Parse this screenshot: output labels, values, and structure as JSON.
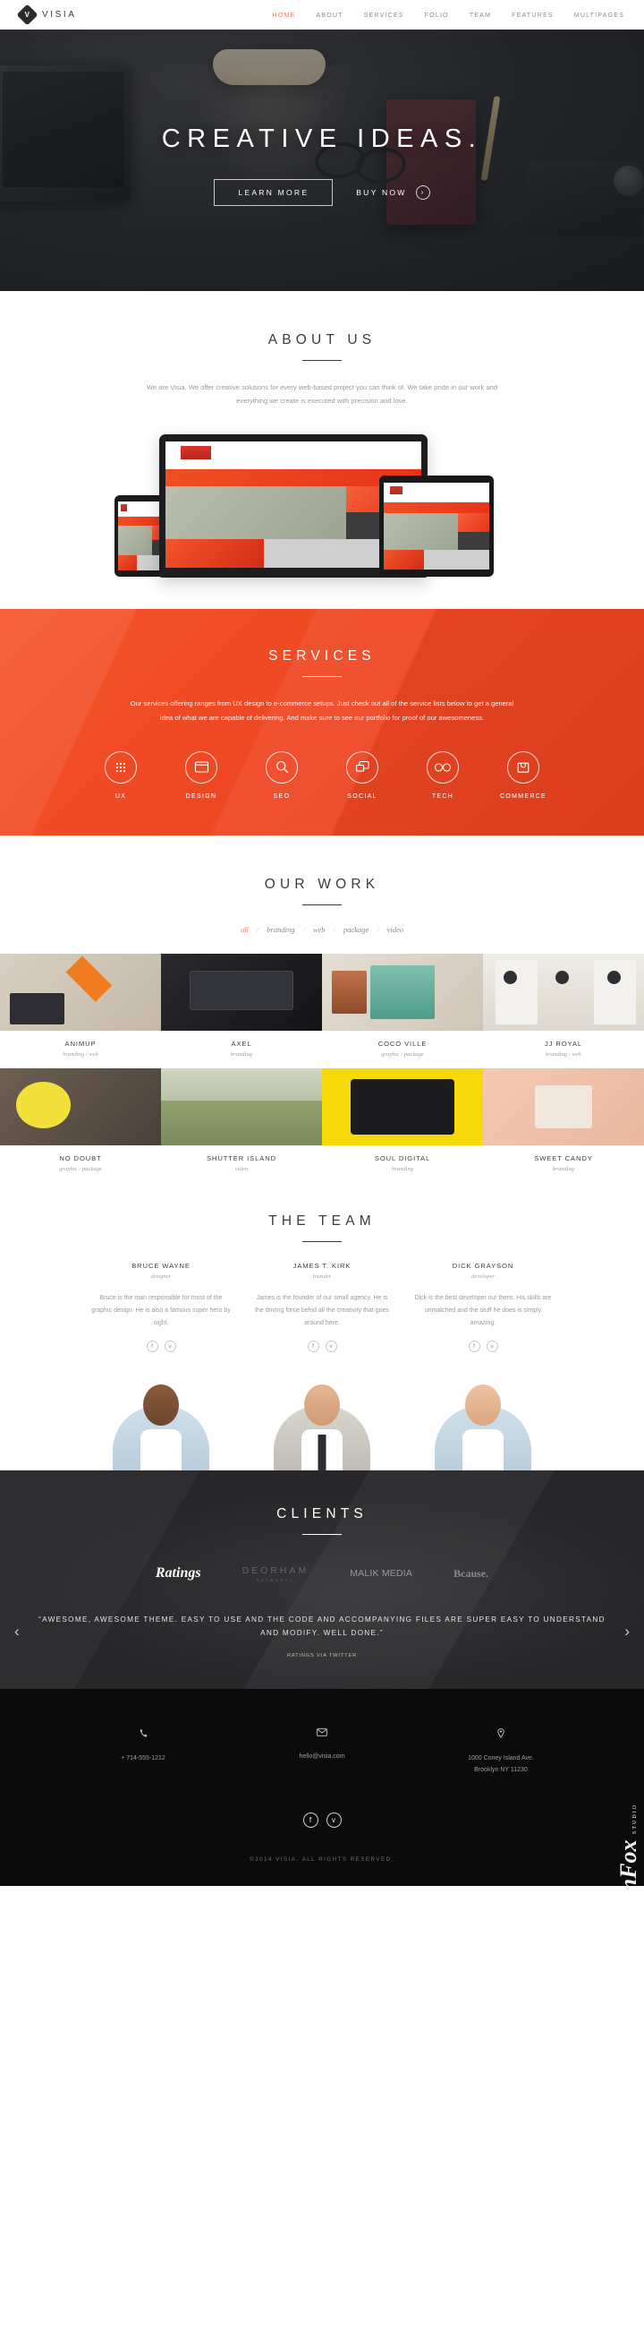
{
  "brand": {
    "name": "VISIA",
    "mark_letter": "V"
  },
  "nav": {
    "items": [
      {
        "label": "HOME",
        "active": true
      },
      {
        "label": "ABOUT",
        "active": false
      },
      {
        "label": "SERVICES",
        "active": false
      },
      {
        "label": "FOLIO",
        "active": false
      },
      {
        "label": "TEAM",
        "active": false
      },
      {
        "label": "FEATURES",
        "active": false
      },
      {
        "label": "MULTIPAGES",
        "active": false
      }
    ],
    "accent_color": "#f4796b"
  },
  "hero": {
    "title": "CREATIVE IDEAS.",
    "primary_button": "LEARN MORE",
    "secondary_button": "BUY NOW",
    "arrow_icon": "›"
  },
  "about": {
    "title": "ABOUT US",
    "paragraph": "We are Visia. We offer creative solutions for every web-based project you can think of. We take pride in our work and everything we create is executed with precision and love."
  },
  "services": {
    "title": "SERVICES",
    "paragraph": "Our services offering ranges from UX design to e-commerce setups. Just check out all of the service lists below to get a general idea of what we are capable of delivering. And make sure to see our portfolio for proof of our awesomeness.",
    "background_color": "#ef4723",
    "items": [
      {
        "label": "UX",
        "icon": "dots-grid-icon"
      },
      {
        "label": "DESIGN",
        "icon": "window-icon"
      },
      {
        "label": "SEO",
        "icon": "magnifier-icon"
      },
      {
        "label": "SOCIAL",
        "icon": "chat-bubbles-icon"
      },
      {
        "label": "TECH",
        "icon": "glasses-icon"
      },
      {
        "label": "COMMERCE",
        "icon": "shopping-bag-icon"
      }
    ]
  },
  "portfolio": {
    "title": "OUR WORK",
    "filters": [
      {
        "label": "all",
        "active": true
      },
      {
        "label": "branding",
        "active": false
      },
      {
        "label": "web",
        "active": false
      },
      {
        "label": "package",
        "active": false
      },
      {
        "label": "video",
        "active": false
      }
    ],
    "items": [
      {
        "title": "ANIMUP",
        "tags": "branding / web",
        "art": "t-animup"
      },
      {
        "title": "AXEL",
        "tags": "branding",
        "art": "t-axel"
      },
      {
        "title": "COCO VILLE",
        "tags": "graphic / package",
        "art": "t-coco"
      },
      {
        "title": "JJ ROYAL",
        "tags": "branding / web",
        "art": "t-jj"
      },
      {
        "title": "NO DOUBT",
        "tags": "graphic / package",
        "art": "t-nodoubt"
      },
      {
        "title": "SHUTTER ISLAND",
        "tags": "video",
        "art": "t-shutter"
      },
      {
        "title": "SOUL DIGITAL",
        "tags": "branding",
        "art": "t-soul"
      },
      {
        "title": "SWEET CANDY",
        "tags": "branding",
        "art": "t-sweet"
      }
    ]
  },
  "team": {
    "title": "THE TEAM",
    "members": [
      {
        "name": "BRUCE WAYNE",
        "role": "designer",
        "bio": "Bruce is the man responsible for most of the graphic design. He is also a famous super hero by night.",
        "facebook": "f",
        "twitter": "ᴠ"
      },
      {
        "name": "JAMES T. KIRK",
        "role": "founder",
        "bio": "James is the founder of our small agency. He is the driving force behid all the creativity that goes around here.",
        "facebook": "f",
        "twitter": "ᴠ"
      },
      {
        "name": "DICK GRAYSON",
        "role": "developer",
        "bio": "Dick is the best developer out there. His skills are unmatched and the stuff he does is simply amazing.",
        "facebook": "f",
        "twitter": "ᴠ"
      }
    ]
  },
  "clients": {
    "title": "CLIENTS",
    "logos": [
      {
        "name": "Ratings",
        "style": "script"
      },
      {
        "name": "DEORHAM",
        "sub": "NETWORKS",
        "style": "stacked"
      },
      {
        "name": "MALIK MEDIA",
        "style": "split-bold"
      },
      {
        "name": "Bcause.",
        "style": "serif-bold"
      }
    ],
    "testimonial": "“AWESOME, AWESOME THEME. EASY TO USE AND THE CODE AND ACCOMPANYING FILES ARE SUPER EASY TO UNDERSTAND AND MODIFY. WELL DONE.”",
    "testimonial_author": "RATINGS VIA TWITTER",
    "prev_arrow": "‹",
    "next_arrow": "›"
  },
  "footer": {
    "contacts": [
      {
        "icon": "phone-icon",
        "glyph": "✆",
        "text": "+ 714-555-1212"
      },
      {
        "icon": "mail-icon",
        "glyph": "✉",
        "text": "hello@visia.com"
      },
      {
        "icon": "location-pin-icon",
        "glyph": "⚲",
        "text": "1000 Coney Island Ave.\nBrooklyn NY 11230"
      }
    ],
    "social": [
      {
        "icon": "facebook-icon",
        "glyph": "f"
      },
      {
        "icon": "twitter-icon",
        "glyph": "ᴠ"
      }
    ],
    "copyright": "©2014 VISIA. ALL RIGHTS RESERVED.",
    "watermark": "JoomFox",
    "watermark_sub": "STUDIO"
  }
}
